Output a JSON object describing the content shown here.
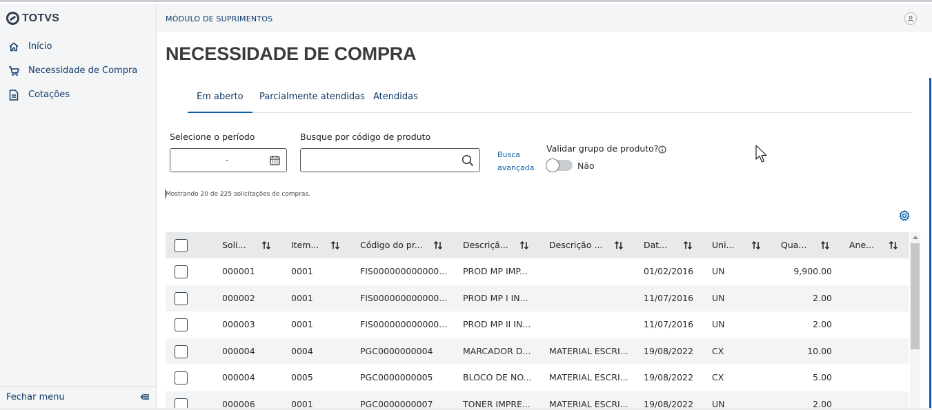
{
  "sidebar": {
    "brand": "TOTVS",
    "items": [
      {
        "label": "Início",
        "icon": "home-icon"
      },
      {
        "label": "Necessidade de Compra",
        "icon": "cart-icon"
      },
      {
        "label": "Cotações",
        "icon": "document-icon"
      }
    ],
    "footer_label": "Fechar menu"
  },
  "header": {
    "module": "MÓDULO DE SUPRIMENTOS"
  },
  "page": {
    "title": "NECESSIDADE DE COMPRA"
  },
  "tabs": [
    {
      "label": "Em aberto",
      "active": true
    },
    {
      "label": "Parcialmente atendidas",
      "active": false
    },
    {
      "label": "Atendidas",
      "active": false
    }
  ],
  "filters": {
    "period_label": "Selecione o período",
    "period_value": "-",
    "product_search_label": "Busque por código de produto",
    "product_search_value": "",
    "advanced_search_line1": "Busca",
    "advanced_search_line2": "avançada",
    "validate_group_label": "Validar grupo de produto?",
    "validate_group_value": "Não"
  },
  "showing_text": "Mostrando 20 de 225 solicitações de compras.",
  "table": {
    "columns": [
      "Soli...",
      "Item...",
      "Código do pr...",
      "Descriçã...",
      "Descrição ...",
      "Dat...",
      "Uni...",
      "Qua...",
      "Ane..."
    ],
    "rows": [
      [
        "000001",
        "0001",
        "FIS000000000000...",
        "PROD MP IMP...",
        "",
        "01/02/2016",
        "UN",
        "9,900.00",
        ""
      ],
      [
        "000002",
        "0001",
        "FIS000000000000...",
        "PROD MP I IN...",
        "",
        "11/07/2016",
        "UN",
        "2.00",
        ""
      ],
      [
        "000003",
        "0001",
        "FIS000000000000...",
        "PROD MP II IN...",
        "",
        "11/07/2016",
        "UN",
        "2.00",
        ""
      ],
      [
        "000004",
        "0004",
        "PGC0000000004",
        "MARCADOR D...",
        "MATERIAL ESCRI...",
        "19/08/2022",
        "CX",
        "10.00",
        ""
      ],
      [
        "000004",
        "0005",
        "PGC0000000005",
        "BLOCO DE NO...",
        "MATERIAL ESCRI...",
        "19/08/2022",
        "CX",
        "5.00",
        ""
      ],
      [
        "000006",
        "0001",
        "PGC0000000007",
        "TONER IMPRE...",
        "MATERIAL ESCRI...",
        "19/08/2022",
        "UN",
        "2.00",
        ""
      ]
    ]
  },
  "colors": {
    "primary": "#0c5ea8",
    "nav_text": "#0c3a66",
    "sidebar_bg": "#f4f5f6",
    "header_row_bg": "#e7e9eb"
  }
}
